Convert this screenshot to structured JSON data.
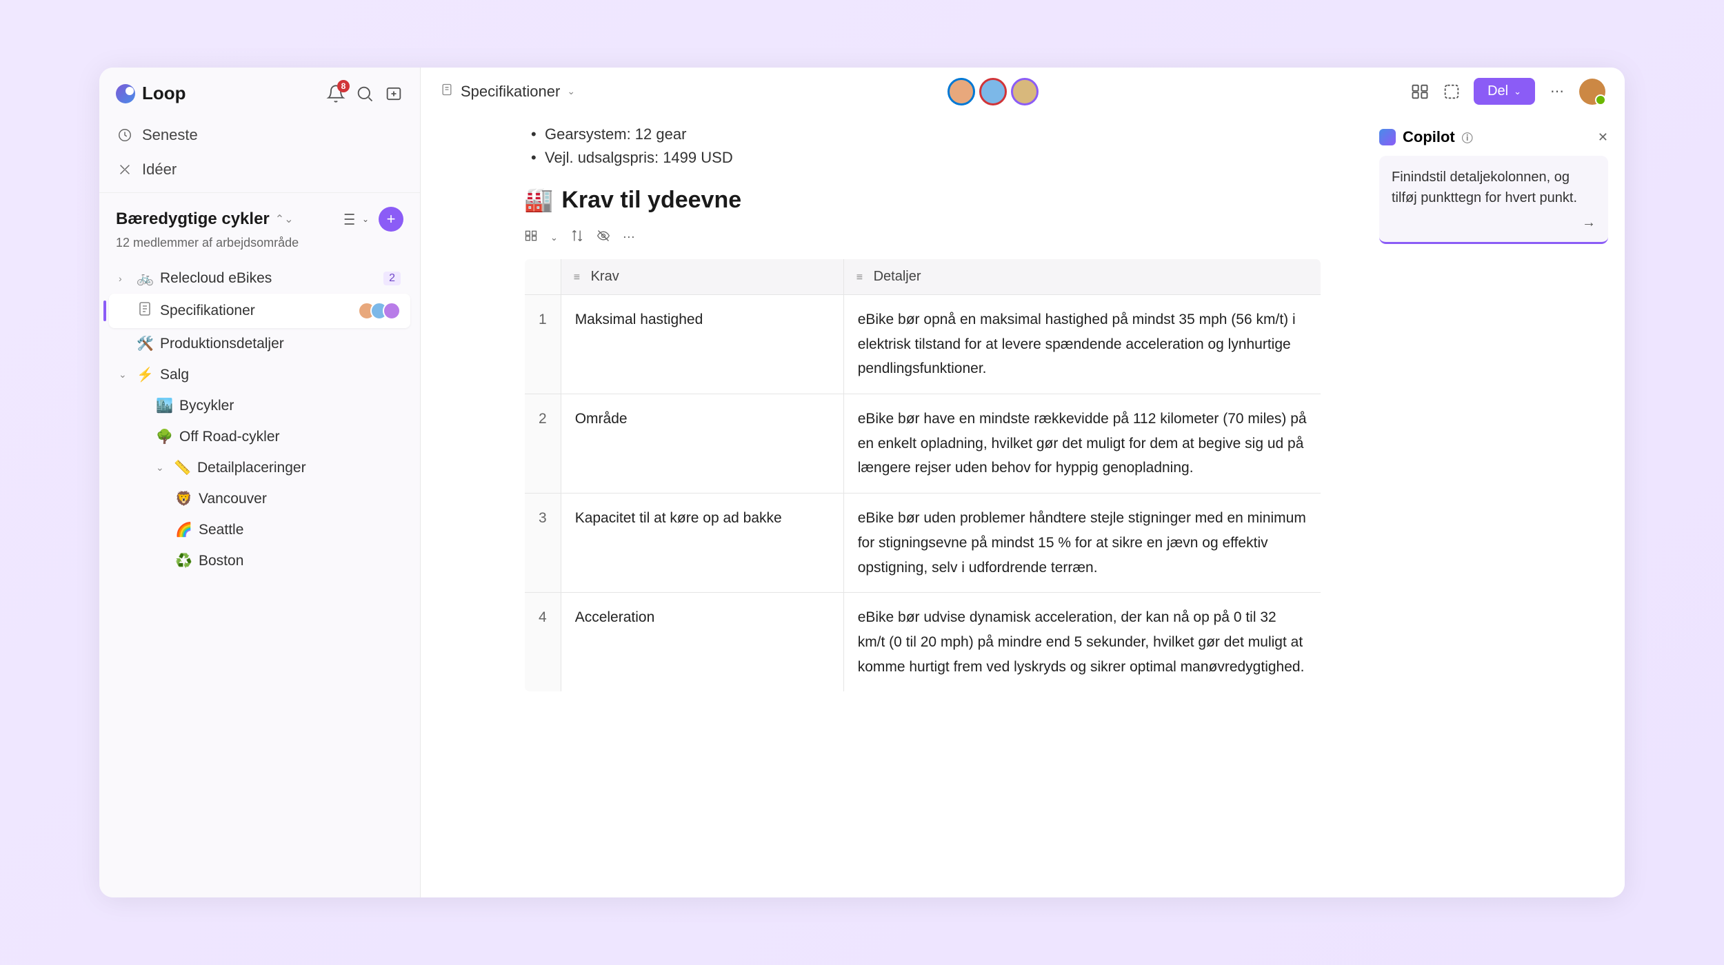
{
  "app": {
    "name": "Loop"
  },
  "header": {
    "notification_count": "8",
    "breadcrumb": "Specifikationer",
    "share_label": "Del"
  },
  "nav": {
    "recent": "Seneste",
    "ideas": "Idéer"
  },
  "workspace": {
    "title": "Bæredygtige cykler",
    "subtitle": "12 medlemmer af arbejdsområde"
  },
  "tree": {
    "relecloud": {
      "label": "Relecloud eBikes",
      "badge": "2",
      "icon": "🚲"
    },
    "specs": {
      "label": "Specifikationer",
      "icon": "📄"
    },
    "prod": {
      "label": "Produktionsdetaljer",
      "icon": "🛠️"
    },
    "salg": {
      "label": "Salg",
      "icon": "⚡"
    },
    "bycykler": {
      "label": "Bycykler",
      "icon": "🏙️"
    },
    "offroad": {
      "label": "Off Road-cykler",
      "icon": "🌳"
    },
    "detail": {
      "label": "Detailplaceringer",
      "icon": "📏"
    },
    "vancouver": {
      "label": "Vancouver",
      "icon": "🦁"
    },
    "seattle": {
      "label": "Seattle",
      "icon": "🌈"
    },
    "boston": {
      "label": "Boston",
      "icon": "♻️"
    }
  },
  "document": {
    "bullets": [
      "Gearsystem: 12 gear",
      "Vejl. udsalgspris: 1499 USD"
    ],
    "heading_icon": "🏭",
    "heading": "Krav til ydeevne",
    "columns": {
      "krav": "Krav",
      "detaljer": "Detaljer"
    },
    "rows": [
      {
        "n": "1",
        "krav": "Maksimal hastighed",
        "detaljer": "eBike bør opnå en maksimal hastighed på mindst 35 mph (56 km/t) i elektrisk tilstand for at levere spændende acceleration og lynhurtige pendlingsfunktioner."
      },
      {
        "n": "2",
        "krav": "Område",
        "detaljer": "eBike bør have en mindste rækkevidde på 112 kilometer (70 miles) på en enkelt opladning, hvilket gør det muligt for dem at begive sig ud på længere rejser uden behov for hyppig genopladning."
      },
      {
        "n": "3",
        "krav": "Kapacitet til at køre op ad bakke",
        "detaljer": "eBike bør uden problemer håndtere stejle stigninger med en minimum for stigningsevne på mindst 15 % for at sikre en jævn og effektiv opstigning, selv i udfordrende terræn."
      },
      {
        "n": "4",
        "krav": "Acceleration",
        "detaljer": "eBike bør udvise dynamisk acceleration, der kan nå op på 0 til 32 km/t (0 til 20 mph) på mindre end 5 sekunder, hvilket gør det muligt at komme hurtigt frem ved lyskryds og sikrer optimal manøvredygtighed."
      }
    ]
  },
  "copilot": {
    "title": "Copilot",
    "prompt": "Finindstil detaljekolonnen, og tilføj punkttegn for hvert punkt."
  }
}
